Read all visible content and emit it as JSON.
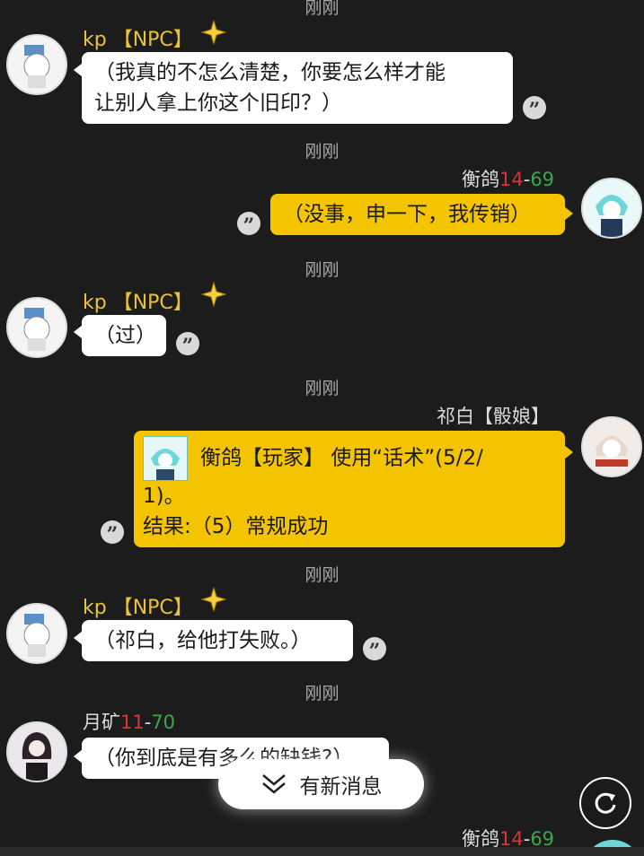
{
  "timestamps": [
    "刚刚",
    "刚刚",
    "刚刚",
    "刚刚",
    "刚刚",
    "刚刚"
  ],
  "messages": [
    {
      "sender": "kp 【NPC】",
      "text_lines": [
        "（我真的不怎么清楚，你要怎么样才能",
        "让别人拿上你这个旧印？）"
      ]
    },
    {
      "sender_name": "衡鸽",
      "sender_hp": "14",
      "sender_sep": "-",
      "sender_san": "69",
      "text": "（没事，申一下，我传销）"
    },
    {
      "sender": "kp 【NPC】",
      "text": "（过）"
    },
    {
      "sender": "祁白【骰娘】",
      "roll_line1": "衡鸽【玩家】 使用“话术”(5/2/",
      "roll_line2": "1)。",
      "roll_line3": "结果:（5）常规成功"
    },
    {
      "sender": "kp 【NPC】",
      "text": "（祁白，给他打失败。）"
    },
    {
      "sender_name": "月矿",
      "sender_hp": "11",
      "sender_sep": "-",
      "sender_san": "70",
      "text": "（你到底是有多么的缺钱?）"
    },
    {
      "sender_name": "衡鸽",
      "sender_hp": "14",
      "sender_sep": "-",
      "sender_san": "69"
    }
  ],
  "new_message_label": "有新消息",
  "quote_symbol": "”",
  "icons": {
    "star": "sparkle-star-icon",
    "quote": "quote-icon",
    "chevron": "double-chevron-down-icon",
    "refresh": "refresh-icon"
  },
  "colors": {
    "npc_name": "#e8c23a",
    "hp": "#d8343c",
    "san": "#3aa84a",
    "yellow_bubble": "#f5c400"
  }
}
